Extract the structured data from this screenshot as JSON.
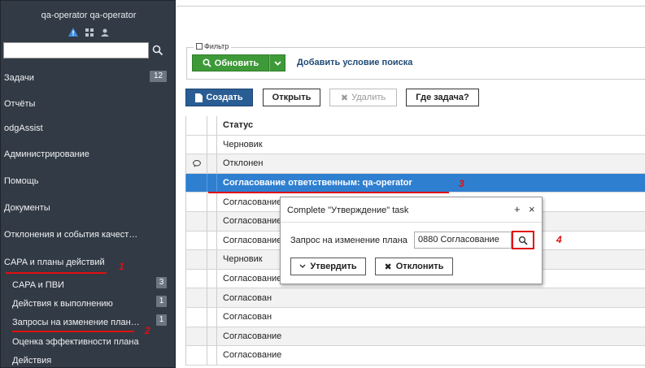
{
  "user": {
    "name": "qa-operator qa-operator"
  },
  "sidebar": {
    "search_placeholder": "",
    "items": [
      {
        "label": "Задачи",
        "badge": "12"
      },
      {
        "label": "Отчёты"
      },
      {
        "label": "odgAssist"
      },
      {
        "label": "Администрирование"
      },
      {
        "label": "Помощь"
      },
      {
        "label": "Документы"
      },
      {
        "label": "Отклонения и события качест…"
      },
      {
        "label": "CAPA и планы действий"
      }
    ],
    "sub_items": [
      {
        "label": "CAPA и ПВИ",
        "badge": "3"
      },
      {
        "label": "Действия к выполнению",
        "badge": "1"
      },
      {
        "label": "Запросы на изменение план…",
        "badge": "1"
      },
      {
        "label": "Оценка эффективности плана"
      },
      {
        "label": "Действия"
      }
    ]
  },
  "annotations": {
    "n1": "1",
    "n2": "2",
    "n3": "3",
    "n4": "4"
  },
  "filter": {
    "legend": "Фильтр",
    "refresh_label": "Обновить",
    "add_condition": "Добавить условие поиска"
  },
  "toolbar": {
    "create": "Создать",
    "open": "Открыть",
    "delete": "Удалить",
    "where_task": "Где задача?"
  },
  "table": {
    "header": "Статус",
    "rows": [
      "Черновик",
      "Отклонен",
      "Согласование ответственным: qa-operator",
      "Согласование",
      "Согласование",
      "Согласование",
      "Черновик",
      "Согласование",
      "Согласован",
      "Согласован",
      "Согласование",
      "Согласование"
    ]
  },
  "dialog": {
    "title": "Complete \"Утверждение\" task",
    "field_label": "Запрос на изменение плана",
    "field_value": "0880 Согласование",
    "approve": "Утвердить",
    "reject": "Отклонить"
  },
  "colors": {
    "sidebar": "#323a45",
    "accent_green": "#3e9a38",
    "accent_blue": "#2a5d94",
    "selected_row": "#2f7fd0",
    "annotation": "#e01010"
  }
}
